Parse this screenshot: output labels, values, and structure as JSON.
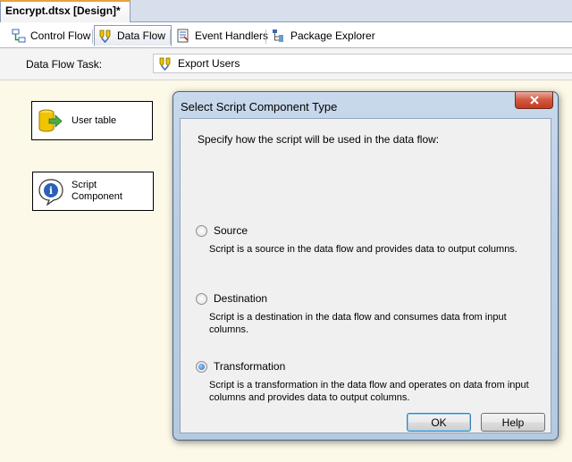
{
  "document_tab": {
    "title": "Encrypt.dtsx [Design]*"
  },
  "designer_tabs": [
    {
      "label": "Control Flow",
      "icon": "control-flow-icon"
    },
    {
      "label": "Data Flow",
      "icon": "data-flow-icon",
      "active": true
    },
    {
      "label": "Event Handlers",
      "icon": "event-handlers-icon"
    },
    {
      "label": "Package Explorer",
      "icon": "package-explorer-icon"
    }
  ],
  "task_bar": {
    "label": "Data Flow Task:",
    "selected_task": "Export Users"
  },
  "canvas": {
    "components": [
      {
        "label": "User table",
        "icon": "database-source-icon"
      },
      {
        "label_line1": "Script",
        "label_line2": "Component",
        "icon": "script-component-icon"
      }
    ]
  },
  "dialog": {
    "title": "Select Script Component Type",
    "instruction": "Specify how the script will be used in the data flow:",
    "options": [
      {
        "label": "Source",
        "description": "Script is a source in the data flow and provides data to output columns.",
        "checked": false
      },
      {
        "label": "Destination",
        "description": "Script is a destination in the data flow and consumes data from input columns.",
        "checked": false
      },
      {
        "label": "Transformation",
        "description_line1": "Script is a transformation in the data flow and operates on data from input",
        "description_line2": "columns and provides data to output columns.",
        "checked": true
      }
    ],
    "ok_label": "OK",
    "help_label": "Help"
  },
  "colors": {
    "active_tab_accent": "#e8a23c",
    "canvas_background": "#fdf9e8",
    "close_button": "#c8472c"
  }
}
